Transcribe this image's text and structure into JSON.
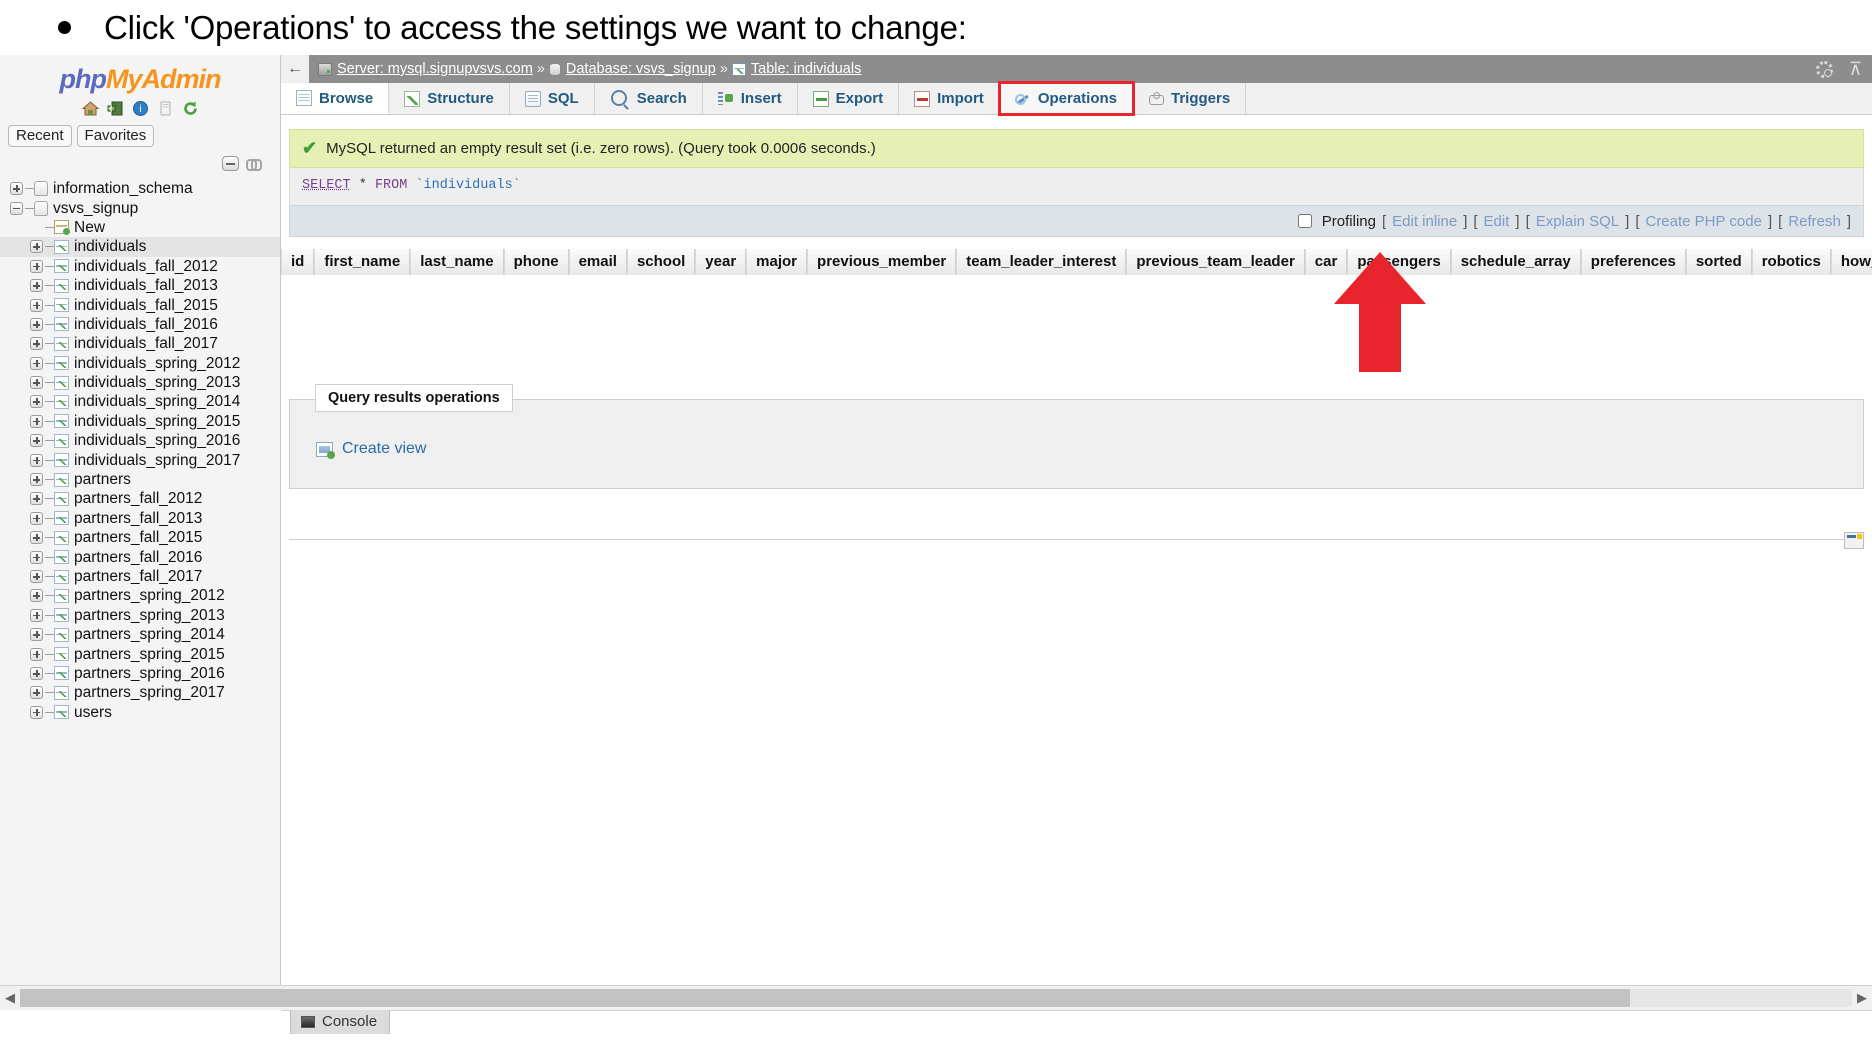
{
  "slide": {
    "bullet": "Click 'Operations' to access the settings we want to change:"
  },
  "sidebar": {
    "logo_php": "php",
    "logo_myadmin": "MyAdmin",
    "quick_icons": [
      "home-icon",
      "logout-icon",
      "docs-icon",
      "wiki-icon",
      "reload-icon"
    ],
    "chips": [
      "Recent",
      "Favorites"
    ],
    "tree": [
      {
        "label": "information_schema",
        "type": "database",
        "expander": "plus",
        "indent": 1,
        "selected": false
      },
      {
        "label": "vsvs_signup",
        "type": "database",
        "expander": "minus",
        "indent": 1,
        "selected": false
      },
      {
        "label": "New",
        "type": "new",
        "expander": "none",
        "indent": 2,
        "selected": false
      },
      {
        "label": "individuals",
        "type": "table",
        "expander": "plus",
        "indent": 2,
        "selected": true
      },
      {
        "label": "individuals_fall_2012",
        "type": "table",
        "expander": "plus",
        "indent": 2,
        "selected": false
      },
      {
        "label": "individuals_fall_2013",
        "type": "table",
        "expander": "plus",
        "indent": 2,
        "selected": false
      },
      {
        "label": "individuals_fall_2015",
        "type": "table",
        "expander": "plus",
        "indent": 2,
        "selected": false
      },
      {
        "label": "individuals_fall_2016",
        "type": "table",
        "expander": "plus",
        "indent": 2,
        "selected": false
      },
      {
        "label": "individuals_fall_2017",
        "type": "table",
        "expander": "plus",
        "indent": 2,
        "selected": false
      },
      {
        "label": "individuals_spring_2012",
        "type": "table",
        "expander": "plus",
        "indent": 2,
        "selected": false
      },
      {
        "label": "individuals_spring_2013",
        "type": "table",
        "expander": "plus",
        "indent": 2,
        "selected": false
      },
      {
        "label": "individuals_spring_2014",
        "type": "table",
        "expander": "plus",
        "indent": 2,
        "selected": false
      },
      {
        "label": "individuals_spring_2015",
        "type": "table",
        "expander": "plus",
        "indent": 2,
        "selected": false
      },
      {
        "label": "individuals_spring_2016",
        "type": "table",
        "expander": "plus",
        "indent": 2,
        "selected": false
      },
      {
        "label": "individuals_spring_2017",
        "type": "table",
        "expander": "plus",
        "indent": 2,
        "selected": false
      },
      {
        "label": "partners",
        "type": "table",
        "expander": "plus",
        "indent": 2,
        "selected": false
      },
      {
        "label": "partners_fall_2012",
        "type": "table",
        "expander": "plus",
        "indent": 2,
        "selected": false
      },
      {
        "label": "partners_fall_2013",
        "type": "table",
        "expander": "plus",
        "indent": 2,
        "selected": false
      },
      {
        "label": "partners_fall_2015",
        "type": "table",
        "expander": "plus",
        "indent": 2,
        "selected": false
      },
      {
        "label": "partners_fall_2016",
        "type": "table",
        "expander": "plus",
        "indent": 2,
        "selected": false
      },
      {
        "label": "partners_fall_2017",
        "type": "table",
        "expander": "plus",
        "indent": 2,
        "selected": false
      },
      {
        "label": "partners_spring_2012",
        "type": "table",
        "expander": "plus",
        "indent": 2,
        "selected": false
      },
      {
        "label": "partners_spring_2013",
        "type": "table",
        "expander": "plus",
        "indent": 2,
        "selected": false
      },
      {
        "label": "partners_spring_2014",
        "type": "table",
        "expander": "plus",
        "indent": 2,
        "selected": false
      },
      {
        "label": "partners_spring_2015",
        "type": "table",
        "expander": "plus",
        "indent": 2,
        "selected": false
      },
      {
        "label": "partners_spring_2016",
        "type": "table",
        "expander": "plus",
        "indent": 2,
        "selected": false
      },
      {
        "label": "partners_spring_2017",
        "type": "table",
        "expander": "plus",
        "indent": 2,
        "selected": false
      },
      {
        "label": "users",
        "type": "table",
        "expander": "plus",
        "indent": 2,
        "selected": false
      }
    ]
  },
  "breadcrumb": {
    "back_arrow": "←",
    "server_label": "Server: mysql.signupvsvs.com",
    "database_label": "Database: vsvs_signup",
    "table_label": "Table: individuals",
    "separator": "»"
  },
  "tabs": [
    {
      "label": "Browse",
      "icon": "browse-icon",
      "active": true,
      "highlighted": false
    },
    {
      "label": "Structure",
      "icon": "structure-icon",
      "active": false,
      "highlighted": false
    },
    {
      "label": "SQL",
      "icon": "sql-icon",
      "active": false,
      "highlighted": false
    },
    {
      "label": "Search",
      "icon": "search-icon",
      "active": false,
      "highlighted": false
    },
    {
      "label": "Insert",
      "icon": "insert-icon",
      "active": false,
      "highlighted": false
    },
    {
      "label": "Export",
      "icon": "export-icon",
      "active": false,
      "highlighted": false
    },
    {
      "label": "Import",
      "icon": "import-icon",
      "active": false,
      "highlighted": false
    },
    {
      "label": "Operations",
      "icon": "operations-icon",
      "active": false,
      "highlighted": true
    },
    {
      "label": "Triggers",
      "icon": "triggers-icon",
      "active": false,
      "highlighted": false
    }
  ],
  "result": {
    "success_message": "MySQL returned an empty result set (i.e. zero rows). (Query took 0.0006 seconds.)",
    "sql": {
      "keyword_select": "SELECT",
      "star": "*",
      "keyword_from": "FROM",
      "identifier": "`individuals`"
    },
    "actions": {
      "profiling_label": "Profiling",
      "links": [
        "Edit inline",
        "Edit",
        "Explain SQL",
        "Create PHP code",
        "Refresh"
      ]
    },
    "columns": [
      "id",
      "first_name",
      "last_name",
      "phone",
      "email",
      "school",
      "year",
      "major",
      "previous_member",
      "team_leader_interest",
      "previous_team_leader",
      "car",
      "passengers",
      "schedule_array",
      "preferences",
      "sorted",
      "robotics",
      "how_heard"
    ]
  },
  "query_results_operations": {
    "legend": "Query results operations",
    "create_view_label": "Create view"
  },
  "console": {
    "label": "Console"
  },
  "colors": {
    "accent_red": "#e8242d",
    "tab_link": "#235a81",
    "success_bg": "#e6f0b5",
    "breadcrumb_bg": "#8d8d8d",
    "logo_orange": "#f7941d",
    "logo_blue": "#5c6bc0"
  }
}
